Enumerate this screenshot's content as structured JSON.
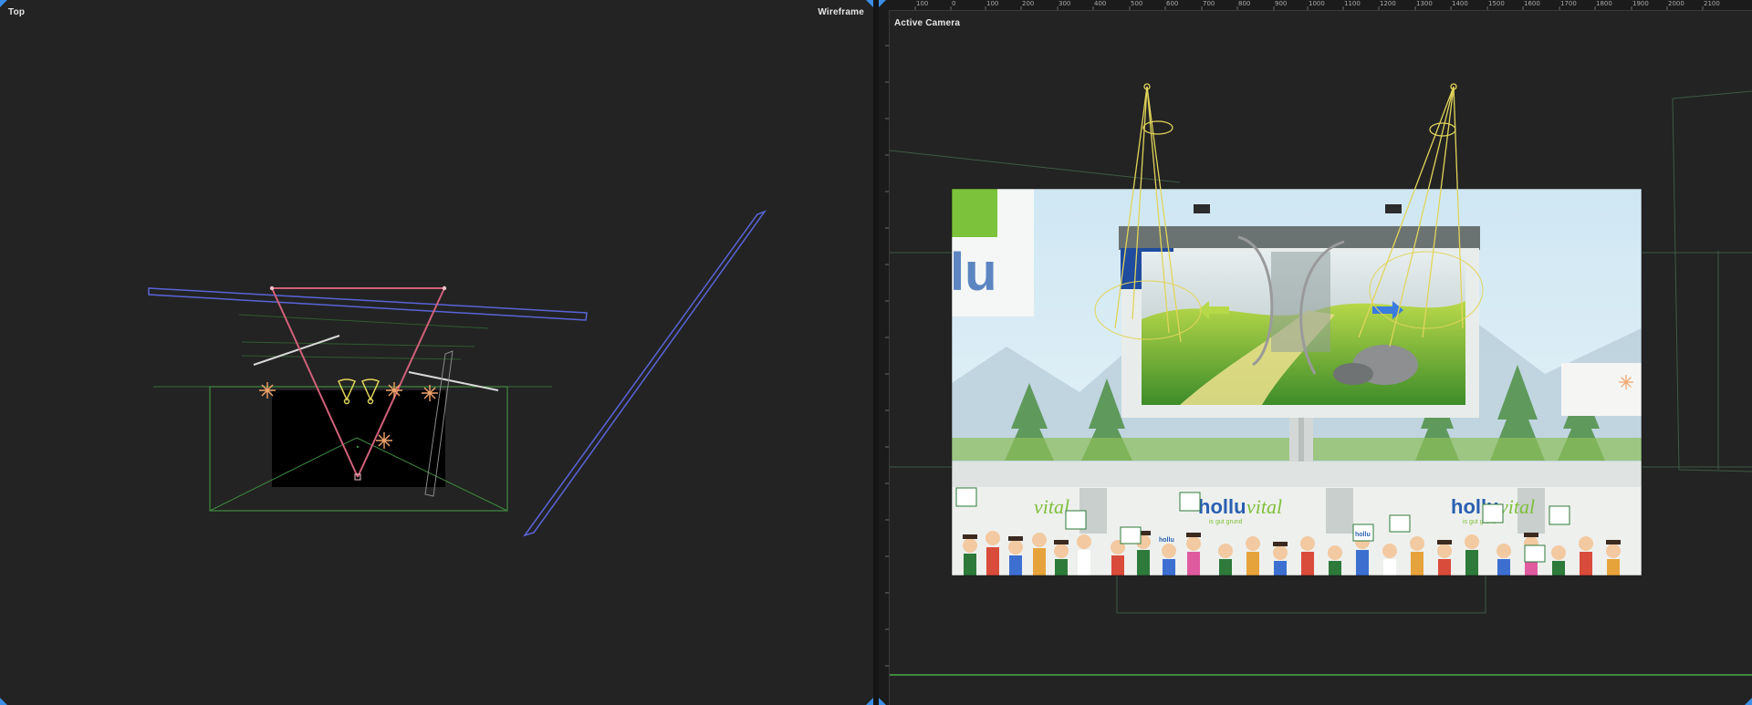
{
  "left_viewport": {
    "label": "Top",
    "mode_label": "Wireframe"
  },
  "right_viewport": {
    "label": "Active Camera",
    "ruler_ticks": [
      "100",
      "0",
      "100",
      "200",
      "300",
      "400",
      "500",
      "600",
      "700",
      "800",
      "900",
      "1000",
      "1100",
      "1200",
      "1300",
      "1400",
      "1500",
      "1600",
      "1700",
      "1800",
      "1900",
      "2000",
      "2100"
    ]
  },
  "scene": {
    "billboard_brand": "hollu",
    "banner_brand_main": "hollu",
    "banner_brand_accent": "vital",
    "banner_tagline": "is gut grund",
    "side_banner_text": "lu",
    "flag_text": "hollu"
  },
  "colors": {
    "background": "#232323",
    "camera_pink": "#d2607a",
    "plane_blue": "#5a64d8",
    "light_yellow": "#e1d55a",
    "green_wire": "#3f8a3f",
    "light_orange": "#f3a46a",
    "viewport_marker": "#3a8ee6"
  }
}
